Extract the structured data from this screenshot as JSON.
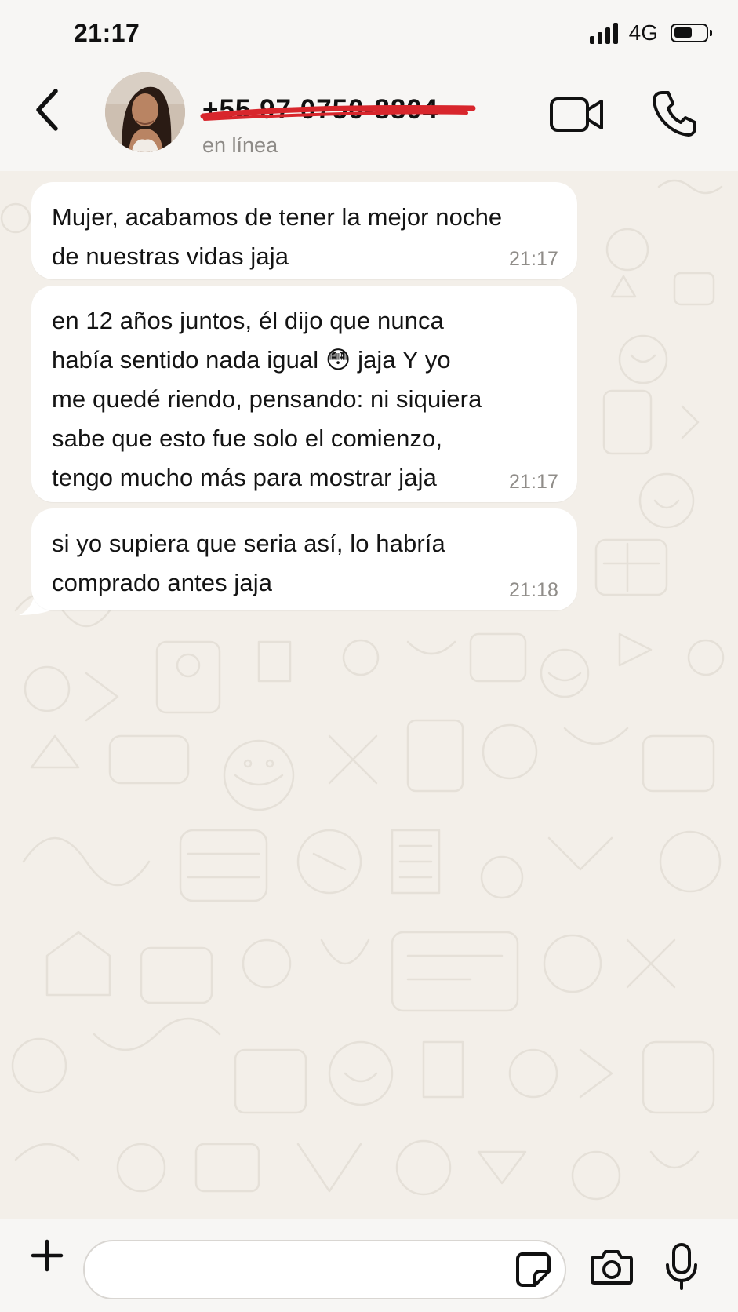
{
  "status_bar": {
    "time": "21:17",
    "network": "4G",
    "battery_fraction": 0.6
  },
  "header": {
    "contact_name": "+55 97 0750-8804",
    "contact_status": "en línea",
    "icons": {
      "back": "chevron-left-icon",
      "video": "video-camera-icon",
      "call": "phone-icon"
    }
  },
  "messages": [
    {
      "lines": [
        "Mujer, acabamos de tener la mejor noche",
        "de nuestras vidas jaja"
      ],
      "time": "21:17"
    },
    {
      "lines": [
        "en 12 años juntos, él dijo que nunca",
        "había sentido nada igual 😳 jaja Y yo",
        "me quedé riendo, pensando: ni siquiera",
        "sabe que esto fue solo el comienzo,",
        "tengo mucho más para mostrar jaja"
      ],
      "time": "21:17"
    },
    {
      "lines": [
        "si yo supiera que seria así, lo habría",
        "comprado antes jaja"
      ],
      "time": "21:18"
    }
  ],
  "input_bar": {
    "placeholder": "",
    "icons": {
      "plus": "plus-icon",
      "sticker": "sticker-icon",
      "camera": "camera-icon",
      "mic": "microphone-icon"
    }
  },
  "colors": {
    "chat_background": "#f3efe9",
    "bubble": "#ffffff",
    "strike": "#d8262c",
    "timestamp": "#908d89"
  }
}
